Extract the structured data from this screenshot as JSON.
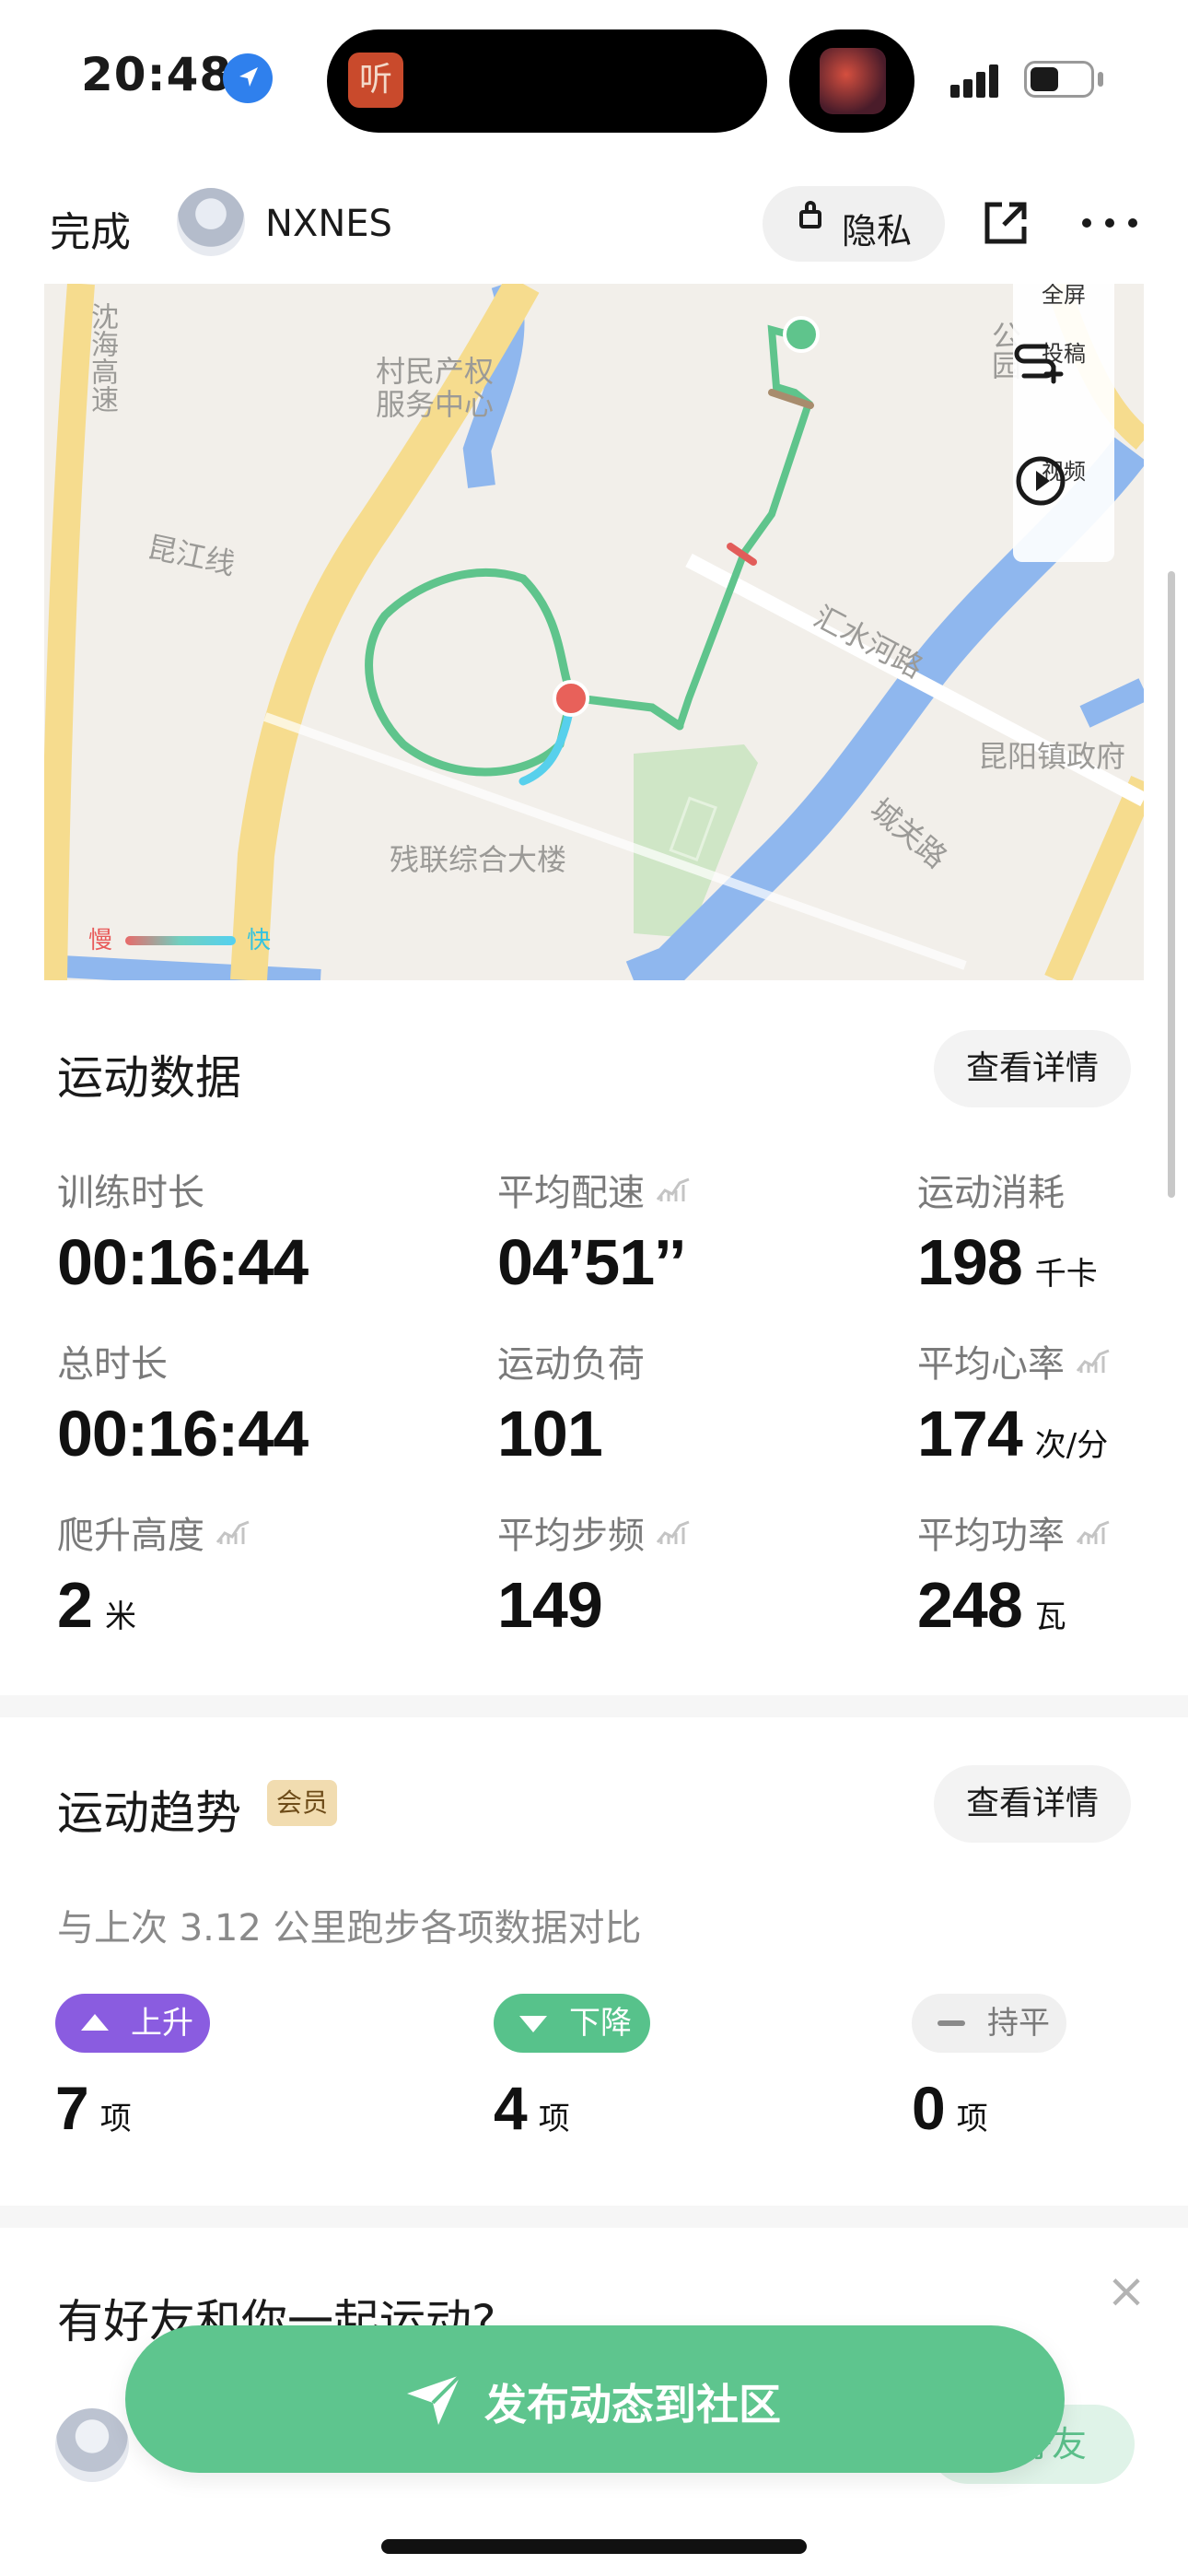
{
  "status_bar": {
    "time": "20:48",
    "app_badge": "听"
  },
  "header": {
    "done_label": "完成",
    "username": "NXNES",
    "privacy_label": "隐私",
    "icons": [
      "lock-icon",
      "share-icon",
      "more-icon"
    ]
  },
  "map": {
    "labels": {
      "highway": "沈海高速",
      "village": "村民产权",
      "service_center": "服务中心",
      "line": "昆江线",
      "road1": "汇水河路",
      "gov": "昆阳镇政府",
      "road2": "城关路",
      "building": "残联综合大楼",
      "partial_right": "公园"
    },
    "controls": {
      "fullscreen": "全屏",
      "submit": "投稿",
      "video": "视频"
    },
    "legend": {
      "slow": "慢",
      "fast": "快"
    },
    "colors": {
      "route": "#5fc48c",
      "slow": "#e8615a",
      "fast": "#4fcfe8",
      "water": "#8fb7ee",
      "road": "#f6dc8e",
      "park": "#cfe6c6"
    }
  },
  "workout": {
    "title": "运动数据",
    "detail_label": "查看详情",
    "stats": [
      {
        "label": "训练时长",
        "value": "00:16:44",
        "unit": "",
        "trend": false
      },
      {
        "label": "平均配速",
        "value": "04’51’’",
        "unit": "",
        "trend": true
      },
      {
        "label": "运动消耗",
        "value": "198",
        "unit": "千卡",
        "trend": false
      },
      {
        "label": "总时长",
        "value": "00:16:44",
        "unit": "",
        "trend": false
      },
      {
        "label": "运动负荷",
        "value": "101",
        "unit": "",
        "trend": false
      },
      {
        "label": "平均心率",
        "value": "174",
        "unit": "次/分",
        "trend": true
      },
      {
        "label": "爬升高度",
        "value": "2",
        "unit": "米",
        "trend": true
      },
      {
        "label": "平均步频",
        "value": "149",
        "unit": "",
        "trend": true
      },
      {
        "label": "平均功率",
        "value": "248",
        "unit": "瓦",
        "trend": true
      }
    ]
  },
  "trend": {
    "title": "运动趋势",
    "vip_badge": "会员",
    "detail_label": "查看详情",
    "compare_text": "与上次 3.12 公里跑步各项数据对比",
    "items": [
      {
        "label": "上升",
        "count": "7",
        "unit": "项",
        "color": "#8a5ce0"
      },
      {
        "label": "下降",
        "count": "4",
        "unit": "项",
        "color": "#57c28b"
      },
      {
        "label": "持平",
        "count": "0",
        "unit": "项",
        "color": "#f0f0f0"
      }
    ]
  },
  "friends": {
    "title": "有好友和你一起运动?",
    "add_label": "好友"
  },
  "publish": {
    "label": "发布动态到社区"
  }
}
